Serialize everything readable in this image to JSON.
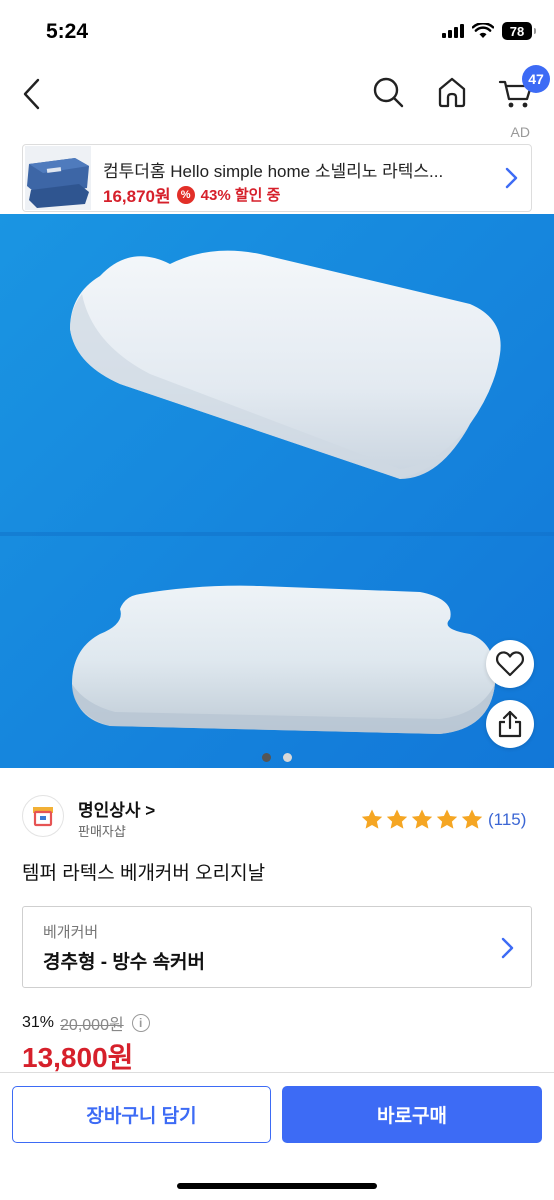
{
  "status_bar": {
    "time": "5:24",
    "battery": "78"
  },
  "nav": {
    "cart_count": "47"
  },
  "ad": {
    "label": "AD",
    "title": "컴투더홈 Hello simple home 소넬리노 라텍스...",
    "price": "16,870원",
    "percent_icon": "%",
    "discount": "43% 할인 중"
  },
  "seller": {
    "name": "명인상사 >",
    "type": "판매자샵"
  },
  "rating": {
    "stars": 5,
    "review_count": "(115)"
  },
  "product": {
    "title": "템퍼 라텍스 베개커버 오리지날",
    "option_label": "베개커버",
    "option_value": "경추형 - 방수 속커버",
    "discount_rate": "31%",
    "original_price": "20,000원",
    "info_icon": "i",
    "sale_price": "13,800원"
  },
  "gallery": {
    "total_images": 2,
    "current_image": 1
  },
  "actions": {
    "cart_label": "장바구니 담기",
    "buy_label": "바로구매"
  },
  "colors": {
    "accent": "#3d6bf5",
    "price_red": "#d6202b",
    "star": "#f5a623",
    "image_bg": "#1f9be6"
  },
  "icons": [
    "back-icon",
    "search-icon",
    "home-icon",
    "cart-icon",
    "chevron-right-icon",
    "heart-icon",
    "share-icon",
    "star-icon",
    "info-icon"
  ]
}
